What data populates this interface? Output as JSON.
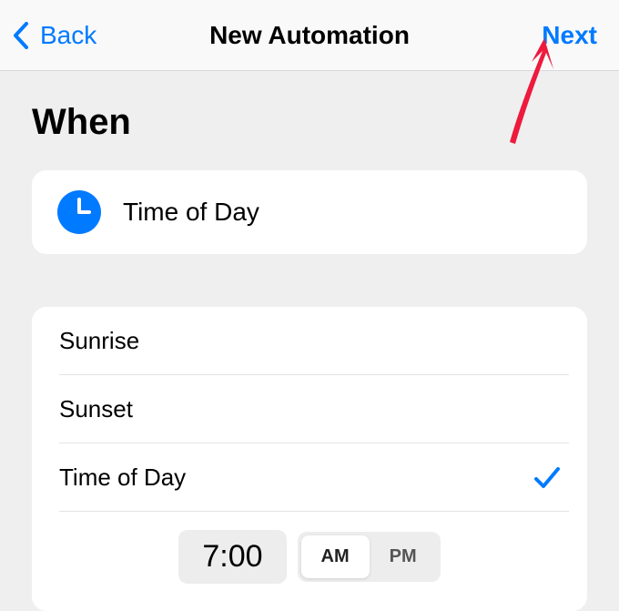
{
  "nav": {
    "back_label": "Back",
    "title": "New Automation",
    "next_label": "Next"
  },
  "section_header": "When",
  "summary": {
    "label": "Time of Day"
  },
  "options": [
    {
      "label": "Sunrise",
      "selected": false
    },
    {
      "label": "Sunset",
      "selected": false
    },
    {
      "label": "Time of Day",
      "selected": true
    }
  ],
  "time_picker": {
    "time": "7:00",
    "am_label": "AM",
    "pm_label": "PM",
    "selected_period": "AM"
  },
  "colors": {
    "accent": "#007aff",
    "arrow_annotation": "#ed1a3d"
  }
}
